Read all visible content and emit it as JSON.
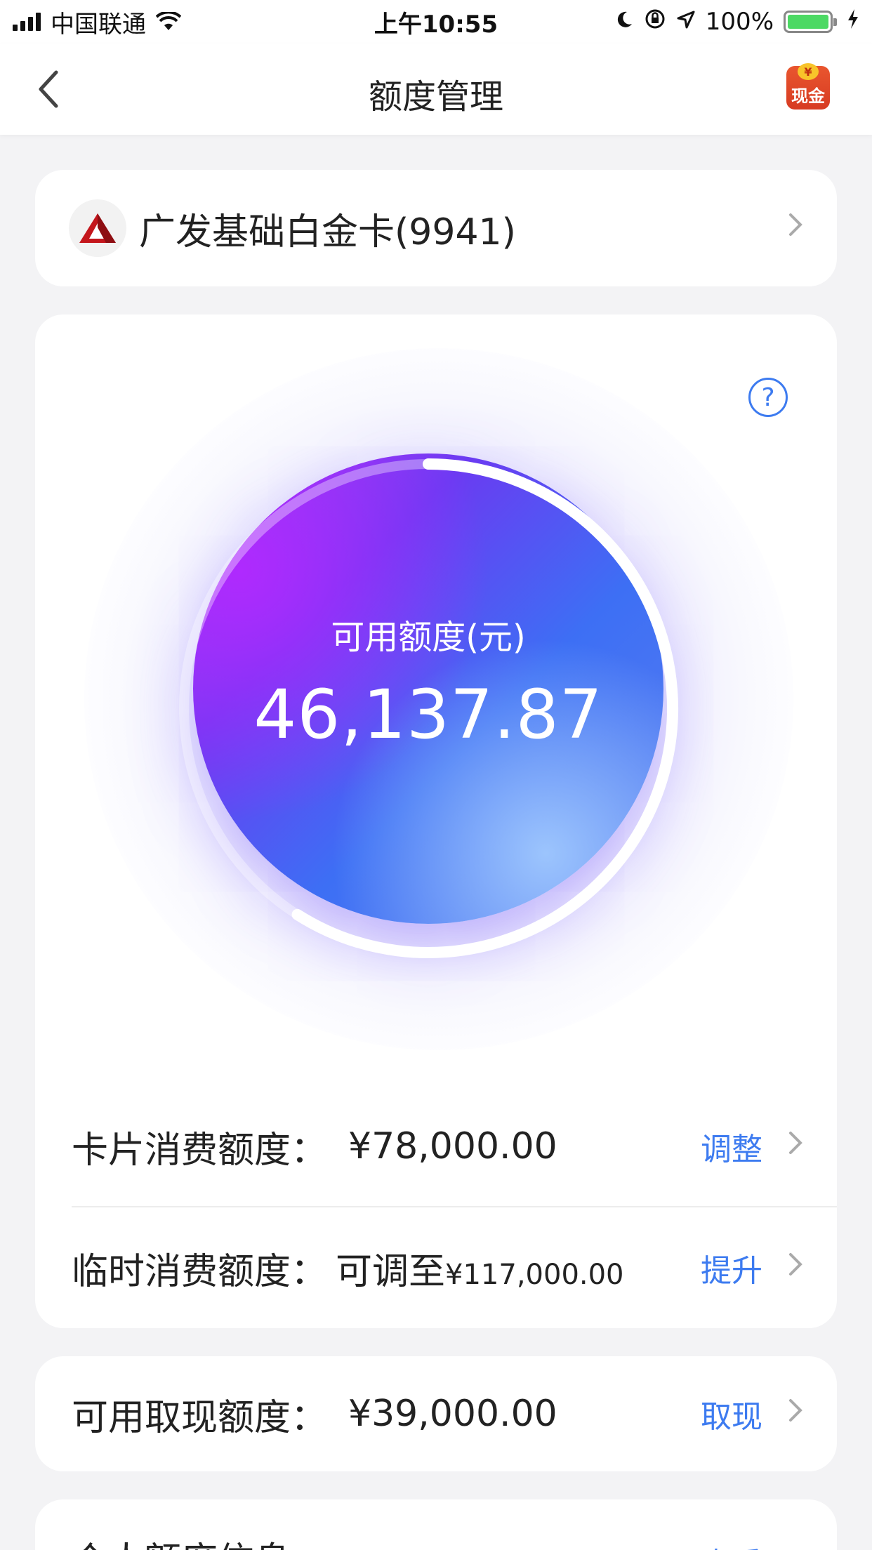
{
  "status_bar": {
    "carrier": "中国联通",
    "time": "上午10:55",
    "battery_percent": "100%",
    "icons": [
      "signal-icon",
      "wifi-icon",
      "moon-icon",
      "rotation-lock-icon",
      "location-icon",
      "battery-icon",
      "charging-icon"
    ]
  },
  "nav": {
    "title": "额度管理",
    "cash_badge": "现金",
    "cash_coin": "¥"
  },
  "card": {
    "name": "广发基础白金卡(9941)"
  },
  "available": {
    "label": "可用额度(元)",
    "amount": "46,137.87",
    "progress_fraction": 0.59
  },
  "rows": {
    "consumption": {
      "label": "卡片消费额度：",
      "value": "¥78,000.00",
      "action": "调整"
    },
    "temporary": {
      "label": "临时消费额度：",
      "prefix": "可调至",
      "value": "¥117,000.00",
      "action": "提升"
    },
    "cash": {
      "label": "可用取现额度：",
      "value": "¥39,000.00",
      "action": "取现"
    },
    "personal": {
      "label": "个人额度信息",
      "action": "查看"
    }
  },
  "colors": {
    "accent": "#3d7bf0",
    "orb_start": "#a63cf4",
    "orb_end": "#3d6ff4",
    "background": "#f3f3f5"
  }
}
